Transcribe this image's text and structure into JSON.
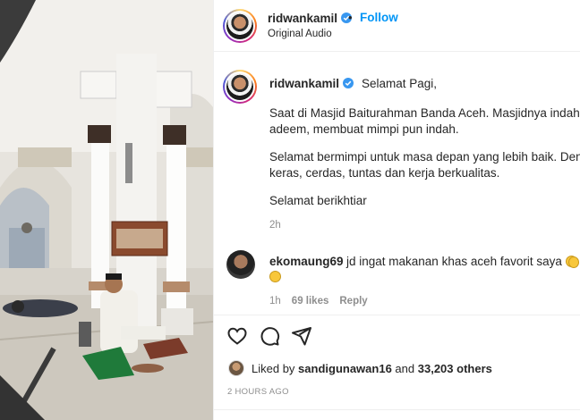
{
  "post": {
    "header": {
      "username": "ridwankamil",
      "separator": "•",
      "follow_label": "Follow",
      "audio_label": "Original Audio"
    },
    "caption": {
      "username": "ridwankamil",
      "greeting": "Selamat Pagi,",
      "paragraph1_line1": "Saat di Masjid Baiturahman Banda Aceh. Masjidnya indah, ub",
      "paragraph1_line2": "adeem, membuat mimpi pun indah.",
      "paragraph2_line1": "Selamat bermimpi untuk masa depan yang lebih baik. Denga",
      "paragraph2_line2": "keras, cerdas, tuntas dan kerja berkualitas.",
      "paragraph3": "Selamat berikhtiar",
      "time": "2h"
    },
    "comment": {
      "username": "ekomaung69",
      "text": "jd ingat makanan khas aceh favorit saya",
      "time": "1h",
      "likes": "69 likes",
      "reply_label": "Reply"
    },
    "likes_summary": {
      "prefix": "Liked by",
      "user": "sandigunawan16",
      "middle": "and",
      "others": "33,203 others"
    },
    "timestamp": "2 HOURS AGO"
  },
  "icons": [
    "verified-badge-icon",
    "heart-icon",
    "comment-icon",
    "share-icon"
  ],
  "colors": {
    "follow_blue": "#0095f6",
    "verified_blue": "#3897f0",
    "muted_text": "#8e8e8e"
  }
}
